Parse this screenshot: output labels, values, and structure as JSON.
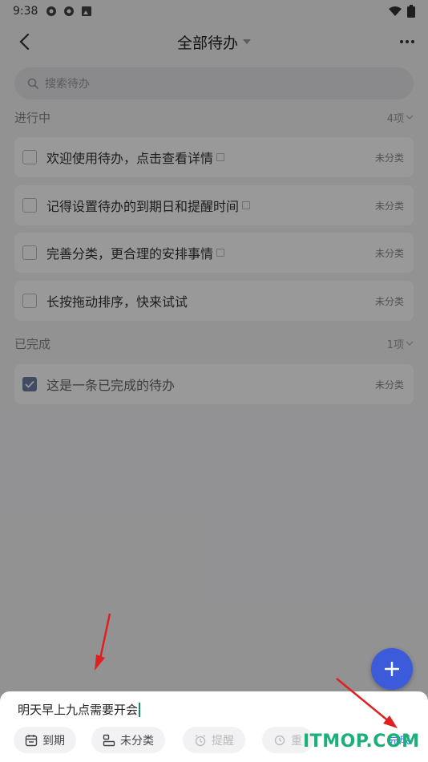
{
  "status_bar": {
    "time": "9:38"
  },
  "header": {
    "title": "全部待办"
  },
  "search": {
    "placeholder": "搜索待办"
  },
  "sections": {
    "in_progress": {
      "label": "进行中",
      "count": "4项"
    },
    "completed": {
      "label": "已完成",
      "count": "1项"
    }
  },
  "todos": [
    {
      "text": "欢迎使用待办，点击查看详情",
      "category": "未分类",
      "has_note": true
    },
    {
      "text": "记得设置待办的到期日和提醒时间",
      "category": "未分类",
      "has_note": true
    },
    {
      "text": "完善分类，更合理的安排事情",
      "category": "未分类",
      "has_note": true
    },
    {
      "text": "长按拖动排序，快来试试",
      "category": "未分类",
      "has_note": false
    }
  ],
  "completed_todos": [
    {
      "text": "这是一条已完成的待办",
      "category": "未分类"
    }
  ],
  "sheet": {
    "input_value": "明天早上九点需要开会",
    "chips": {
      "due": "到期",
      "category": "未分类",
      "remind": "提醒",
      "repeat": "重"
    },
    "done_label": "完成"
  },
  "watermark": "ITMOP.COM",
  "colors": {
    "accent": "#4a6cf0",
    "fab": "#3b5bdb",
    "watermark": "#1bb07a",
    "arrow": "#e02020"
  }
}
